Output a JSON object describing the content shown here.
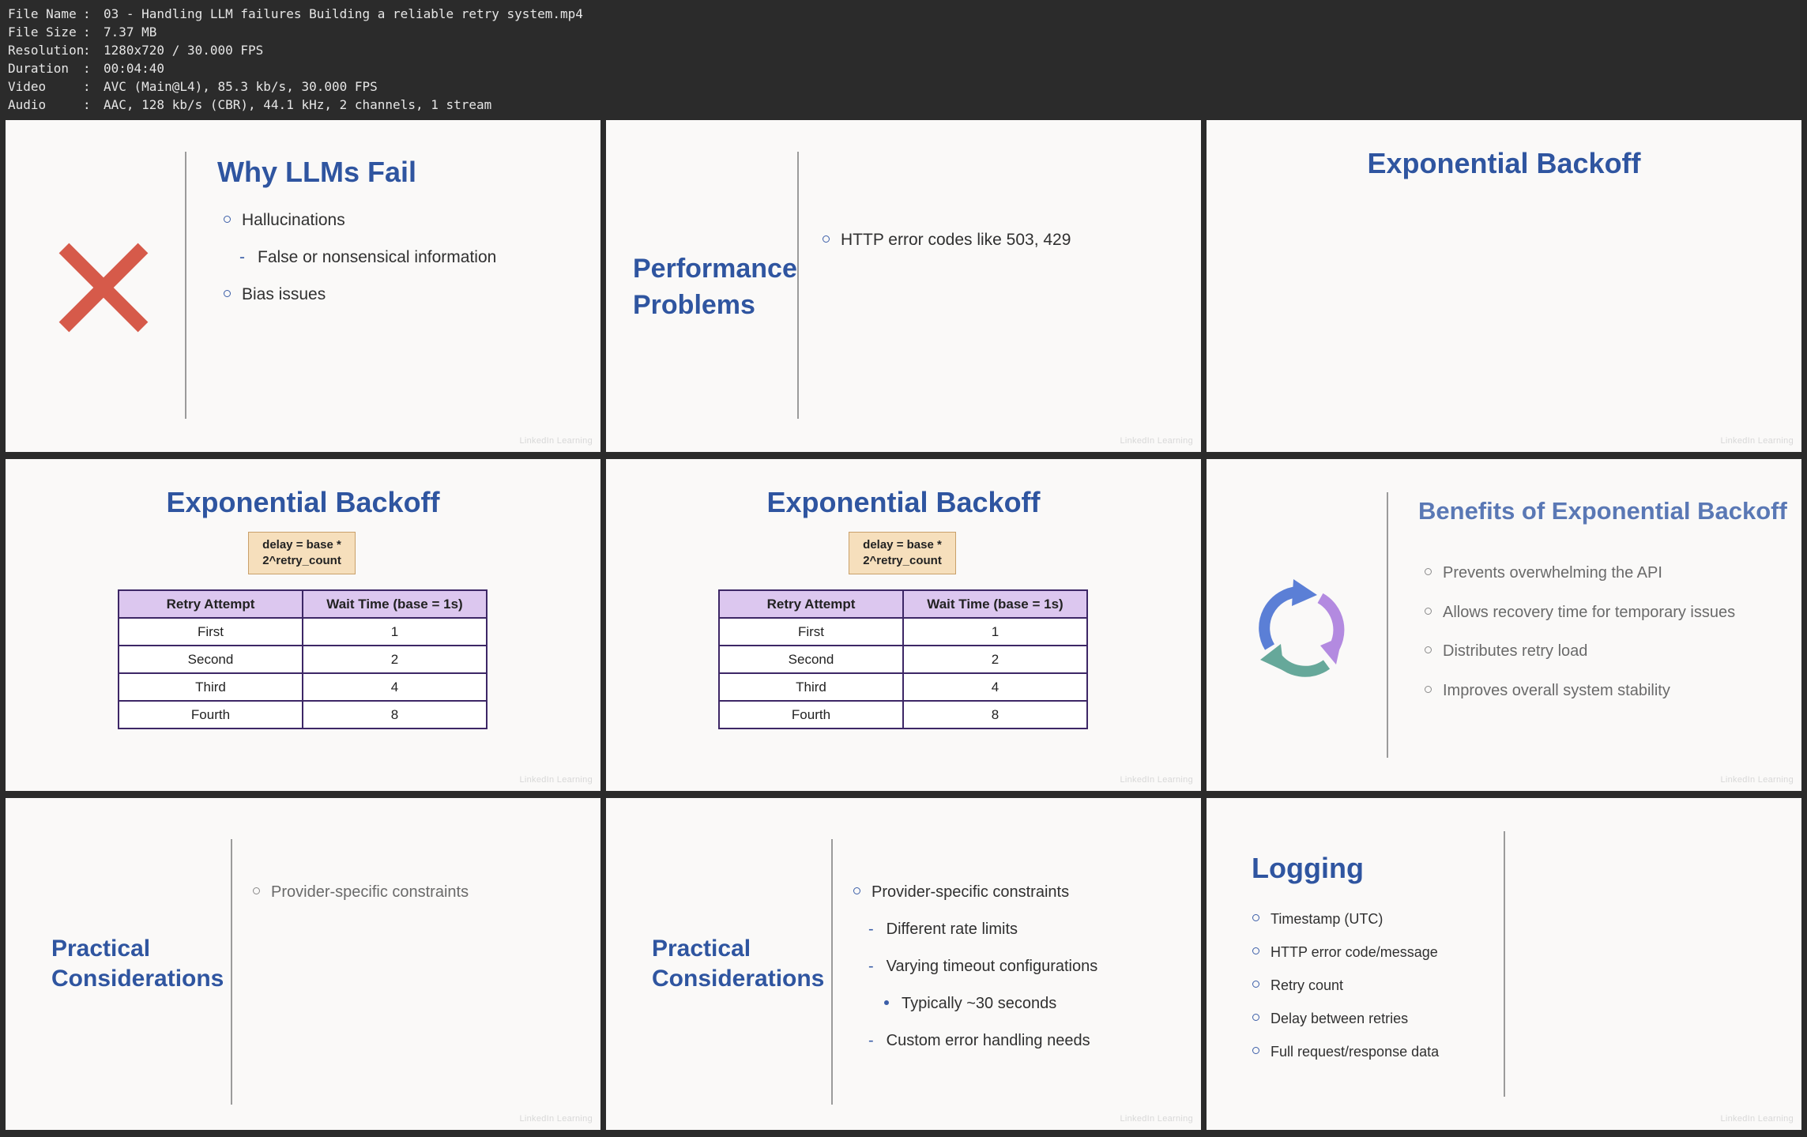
{
  "file_info": [
    {
      "key": "File Name",
      "value": "03 - Handling LLM failures Building a reliable retry system.mp4"
    },
    {
      "key": "File Size",
      "value": "7.37 MB"
    },
    {
      "key": "Resolution",
      "value": "1280x720 / 30.000 FPS"
    },
    {
      "key": "Duration",
      "value": "00:04:40"
    },
    {
      "key": "Video",
      "value": "AVC (Main@L4), 85.3 kb/s, 30.000 FPS"
    },
    {
      "key": "Audio",
      "value": "AAC, 128 kb/s (CBR), 44.1 kHz, 2 channels, 1 stream"
    }
  ],
  "watermark": "LinkedIn Learning",
  "slides": {
    "s1": {
      "title": "Why LLMs Fail",
      "icon": "x-icon",
      "bullets": [
        "Hallucinations",
        "False or nonsensical information",
        "Bias issues"
      ]
    },
    "s2": {
      "title_line1": "Performance",
      "title_line2": "Problems",
      "bullets": [
        "HTTP error codes like 503, 429"
      ]
    },
    "s3": {
      "title": "Exponential Backoff"
    },
    "s4": {
      "title": "Exponential Backoff",
      "formula_line1": "delay = base *",
      "formula_line2": "2^retry_count",
      "headers": [
        "Retry Attempt",
        "Wait Time (base = 1s)"
      ],
      "rows": [
        [
          "First",
          "1"
        ],
        [
          "Second",
          "2"
        ],
        [
          "Third",
          "4"
        ],
        [
          "Fourth",
          "8"
        ]
      ]
    },
    "s5": {
      "title": "Exponential Backoff",
      "formula_line1": "delay = base *",
      "formula_line2": "2^retry_count",
      "headers": [
        "Retry Attempt",
        "Wait Time (base = 1s)"
      ],
      "rows": [
        [
          "First",
          "1"
        ],
        [
          "Second",
          "2"
        ],
        [
          "Third",
          "4"
        ],
        [
          "Fourth",
          "8"
        ]
      ]
    },
    "s6": {
      "title": "Benefits of Exponential Backoff",
      "icon": "cycle-arrows-icon",
      "bullets": [
        "Prevents overwhelming the API",
        "Allows recovery time for temporary issues",
        "Distributes retry load",
        "Improves overall system stability"
      ]
    },
    "s7": {
      "title_line1": "Practical",
      "title_line2": "Considerations",
      "bullets": [
        "Provider-specific constraints"
      ]
    },
    "s8": {
      "title_line1": "Practical",
      "title_line2": "Considerations",
      "bullets": [
        "Provider-specific constraints",
        "Different rate limits",
        "Varying timeout configurations",
        "Typically ~30 seconds",
        "Custom error handling needs"
      ]
    },
    "s9": {
      "title": "Logging",
      "bullets": [
        "Timestamp (UTC)",
        "HTTP error code/message",
        "Retry count",
        "Delay between retries",
        "Full request/response data"
      ]
    }
  }
}
